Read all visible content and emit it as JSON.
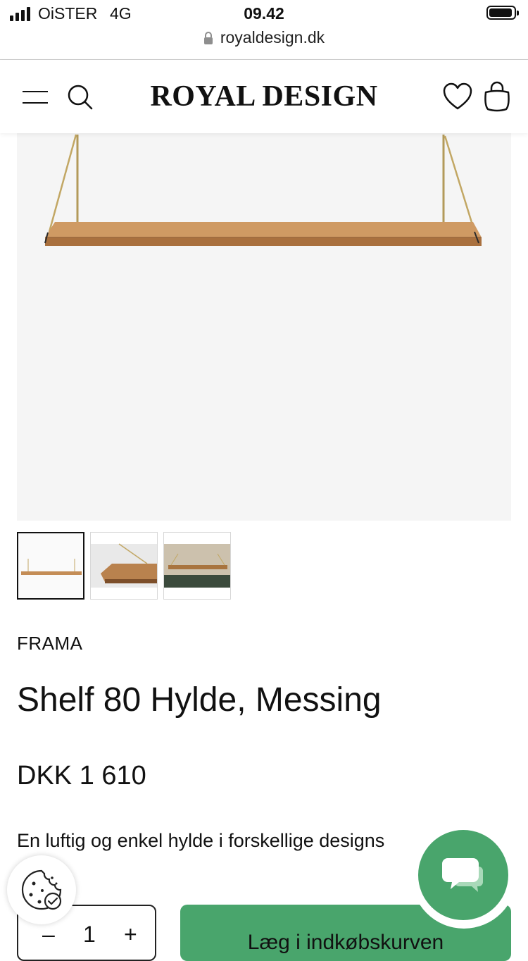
{
  "status_bar": {
    "carrier": "OiSTER",
    "network": "4G",
    "time": "09.42"
  },
  "browser": {
    "url": "royaldesign.dk"
  },
  "header": {
    "logo": "ROYAL DESIGN"
  },
  "product": {
    "brand": "FRAMA",
    "title": "Shelf 80 Hylde, Messing",
    "price": "DKK 1 610",
    "description": "En luftig og enkel hylde i forskellige designs",
    "thumbnails": [
      "shelf-front",
      "shelf-angle",
      "shelf-wall"
    ]
  },
  "purchase": {
    "quantity_minus": "–",
    "quantity": "1",
    "quantity_plus": "+",
    "add_to_cart": "Læg i indkøbskurven"
  },
  "colors": {
    "accent_green": "#49a56c",
    "image_background": "#f5f5f5"
  }
}
